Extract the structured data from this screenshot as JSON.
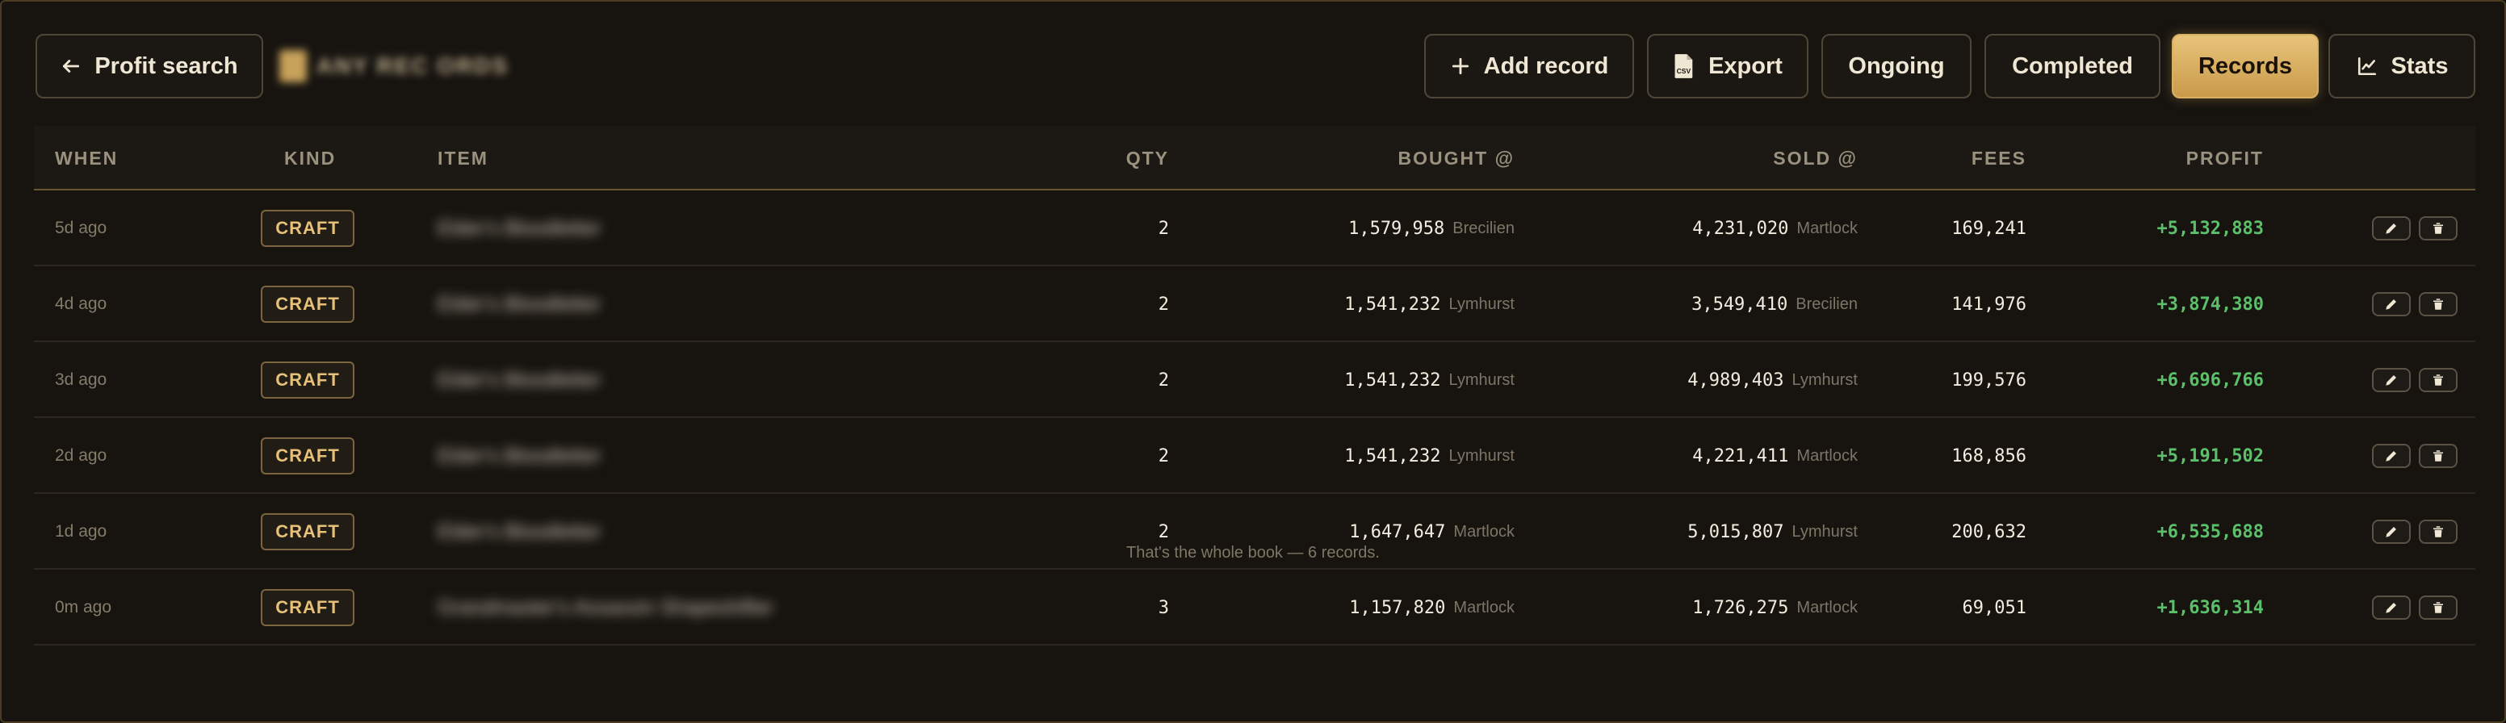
{
  "header": {
    "back_label": "Profit search",
    "brand_text": "ANY REC ORDS",
    "add_label": "Add record",
    "export_label": "Export",
    "export_badge": "CSV",
    "ongoing_label": "Ongoing",
    "completed_label": "Completed",
    "records_label": "Records",
    "stats_label": "Stats"
  },
  "columns": {
    "when": "WHEN",
    "kind": "KIND",
    "item": "ITEM",
    "qty": "QTY",
    "bought": "BOUGHT @",
    "sold": "SOLD @",
    "fees": "FEES",
    "profit": "PROFIT"
  },
  "rows": [
    {
      "when": "5d ago",
      "kind": "CRAFT",
      "item": "Elder's Bloodletter",
      "qty": "2",
      "bought": "1,579,958",
      "bought_city": "Brecilien",
      "sold": "4,231,020",
      "sold_city": "Martlock",
      "fees": "169,241",
      "profit": "+5,132,883"
    },
    {
      "when": "4d ago",
      "kind": "CRAFT",
      "item": "Elder's Bloodletter",
      "qty": "2",
      "bought": "1,541,232",
      "bought_city": "Lymhurst",
      "sold": "3,549,410",
      "sold_city": "Brecilien",
      "fees": "141,976",
      "profit": "+3,874,380"
    },
    {
      "when": "3d ago",
      "kind": "CRAFT",
      "item": "Elder's Bloodletter",
      "qty": "2",
      "bought": "1,541,232",
      "bought_city": "Lymhurst",
      "sold": "4,989,403",
      "sold_city": "Lymhurst",
      "fees": "199,576",
      "profit": "+6,696,766"
    },
    {
      "when": "2d ago",
      "kind": "CRAFT",
      "item": "Elder's Bloodletter",
      "qty": "2",
      "bought": "1,541,232",
      "bought_city": "Lymhurst",
      "sold": "4,221,411",
      "sold_city": "Martlock",
      "fees": "168,856",
      "profit": "+5,191,502"
    },
    {
      "when": "1d ago",
      "kind": "CRAFT",
      "item": "Elder's Bloodletter",
      "qty": "2",
      "bought": "1,647,647",
      "bought_city": "Martlock",
      "sold": "5,015,807",
      "sold_city": "Lymhurst",
      "fees": "200,632",
      "profit": "+6,535,688"
    },
    {
      "when": "0m ago",
      "kind": "CRAFT",
      "item": "Grandmaster's Assassin Shapeshifter",
      "qty": "3",
      "bought": "1,157,820",
      "bought_city": "Martlock",
      "sold": "1,726,275",
      "sold_city": "Martlock",
      "fees": "69,051",
      "profit": "+1,636,314"
    }
  ],
  "footer_text": "That's the whole book — 6 records.",
  "colors": {
    "accent_gold": "#d8b063",
    "profit_green": "#5cc06b",
    "background": "#171410"
  }
}
